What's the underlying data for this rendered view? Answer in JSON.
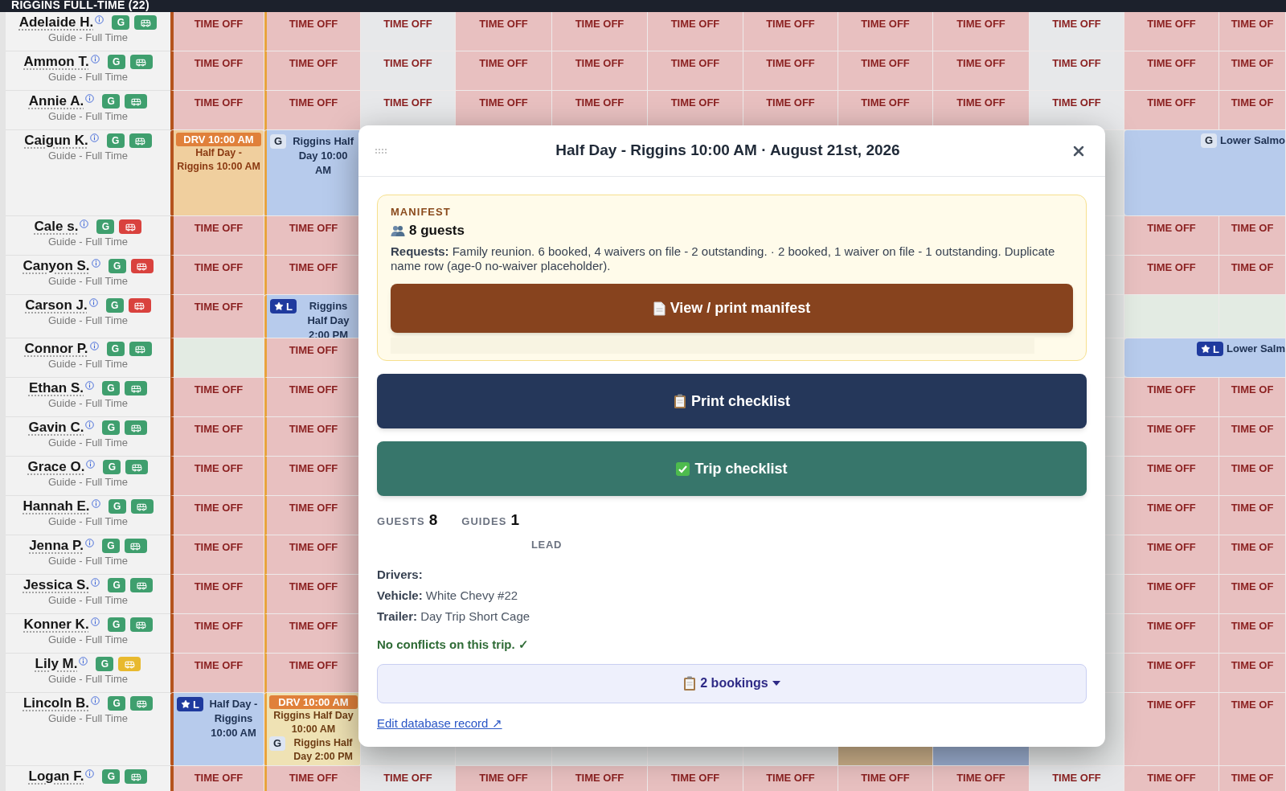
{
  "group": {
    "title": "RIGGINS FULL-TIME (22)"
  },
  "staff": [
    {
      "name": "Adelaide H.",
      "role": "Guide - Full Time",
      "badge": "G",
      "color": "#3f9f6e",
      "cells": [
        {
          "kind": "time_off",
          "text": "TIME OFF"
        },
        {
          "kind": "time_off",
          "text": "TIME OFF"
        },
        {
          "kind": "time_off_grey",
          "text": "TIME OFF"
        },
        {
          "kind": "time_off",
          "text": "TIME OFF"
        },
        {
          "kind": "time_off",
          "text": "TIME OFF"
        },
        {
          "kind": "time_off",
          "text": "TIME OFF"
        },
        {
          "kind": "time_off",
          "text": "TIME OFF"
        },
        {
          "kind": "time_off",
          "text": "TIME OFF"
        },
        {
          "kind": "time_off",
          "text": "TIME OFF"
        },
        {
          "kind": "time_off_grey",
          "text": "TIME OFF"
        },
        {
          "kind": "time_off",
          "text": "TIME OFF"
        },
        {
          "kind": "time_off",
          "text": "TIME OF"
        }
      ]
    },
    {
      "name": "Ammon T.",
      "role": "Guide - Full Time",
      "badge": "G",
      "color": "#3f9f6e",
      "cells": [
        {
          "kind": "time_off",
          "text": "TIME OFF"
        },
        {
          "kind": "time_off",
          "text": "TIME OFF"
        },
        {
          "kind": "time_off_grey",
          "text": "TIME OFF"
        },
        {
          "kind": "time_off",
          "text": "TIME OFF"
        },
        {
          "kind": "time_off",
          "text": "TIME OFF"
        },
        {
          "kind": "time_off",
          "text": "TIME OFF"
        },
        {
          "kind": "time_off",
          "text": "TIME OFF"
        },
        {
          "kind": "time_off",
          "text": "TIME OFF"
        },
        {
          "kind": "time_off",
          "text": "TIME OFF"
        },
        {
          "kind": "time_off_grey",
          "text": "TIME OFF"
        },
        {
          "kind": "time_off",
          "text": "TIME OFF"
        },
        {
          "kind": "time_off",
          "text": "TIME OF"
        }
      ]
    },
    {
      "name": "Annie A.",
      "role": "Guide - Full Time",
      "badge": "G",
      "color": "#3f9f6e",
      "cells": [
        {
          "kind": "time_off",
          "text": "TIME OFF"
        },
        {
          "kind": "time_off",
          "text": "TIME OFF"
        },
        {
          "kind": "time_off_grey",
          "text": "TIME OFF"
        },
        {
          "kind": "time_off",
          "text": "TIME OFF"
        },
        {
          "kind": "time_off",
          "text": "TIME OFF"
        },
        {
          "kind": "time_off",
          "text": "TIME OFF"
        },
        {
          "kind": "time_off",
          "text": "TIME OFF"
        },
        {
          "kind": "time_off",
          "text": "TIME OFF"
        },
        {
          "kind": "time_off",
          "text": "TIME OFF"
        },
        {
          "kind": "time_off_grey",
          "text": "TIME OFF"
        },
        {
          "kind": "time_off",
          "text": "TIME OFF"
        },
        {
          "kind": "time_off",
          "text": "TIME OF"
        }
      ]
    },
    {
      "name": "Caigun K.",
      "role": "Guide - Full Time",
      "badge": "G",
      "color": "#3f9f6e",
      "cells": [
        {
          "kind": "drive",
          "header": "DRV 10:00 AM",
          "text": "Half Day - Riggins 10:00 AM"
        },
        {
          "kind": "trip",
          "lead": false,
          "badge": "G",
          "text": "Riggins Half Day 10:00 AM"
        },
        {
          "kind": "covered"
        },
        {
          "kind": "covered"
        },
        {
          "kind": "covered"
        },
        {
          "kind": "covered"
        },
        {
          "kind": "covered"
        },
        {
          "kind": "covered"
        },
        {
          "kind": "covered"
        },
        {
          "kind": "covered"
        },
        {
          "kind": "trip_wide",
          "lead": false,
          "badge": "G",
          "text": "Lower Salmo"
        }
      ]
    },
    {
      "name": "Cale s.",
      "role": "Guide - Full Time",
      "badge": "G",
      "color": "#d9423e",
      "cells": [
        {
          "kind": "time_off",
          "text": "TIME OFF"
        },
        {
          "kind": "time_off",
          "text": "TIME OFF"
        },
        {
          "kind": "covered"
        },
        {
          "kind": "covered"
        },
        {
          "kind": "covered"
        },
        {
          "kind": "covered"
        },
        {
          "kind": "covered"
        },
        {
          "kind": "covered"
        },
        {
          "kind": "covered"
        },
        {
          "kind": "covered"
        },
        {
          "kind": "time_off",
          "text": "TIME OFF"
        },
        {
          "kind": "time_off",
          "text": "TIME OF"
        }
      ]
    },
    {
      "name": "Canyon S.",
      "role": "Guide - Full Time",
      "badge": "G",
      "color": "#d9423e",
      "cells": [
        {
          "kind": "time_off",
          "text": "TIME OFF"
        },
        {
          "kind": "time_off",
          "text": "TIME OFF"
        },
        {
          "kind": "covered"
        },
        {
          "kind": "covered"
        },
        {
          "kind": "covered"
        },
        {
          "kind": "covered"
        },
        {
          "kind": "covered"
        },
        {
          "kind": "covered"
        },
        {
          "kind": "covered"
        },
        {
          "kind": "covered"
        },
        {
          "kind": "time_off",
          "text": "TIME OFF"
        },
        {
          "kind": "time_off",
          "text": "TIME OF"
        }
      ]
    },
    {
      "name": "Carson J.",
      "role": "Guide - Full Time",
      "badge": "G",
      "color": "#d9423e",
      "cells": [
        {
          "kind": "time_off",
          "text": "TIME OFF"
        },
        {
          "kind": "trip",
          "lead": true,
          "badge": "L",
          "text": "Riggins Half Day 2:00 PM"
        },
        {
          "kind": "covered"
        },
        {
          "kind": "covered"
        },
        {
          "kind": "covered"
        },
        {
          "kind": "covered"
        },
        {
          "kind": "covered"
        },
        {
          "kind": "covered"
        },
        {
          "kind": "covered"
        },
        {
          "kind": "covered"
        },
        {
          "kind": "open"
        },
        {
          "kind": "open"
        }
      ]
    },
    {
      "name": "Connor P.",
      "role": "Guide - Full Time",
      "badge": "G",
      "color": "#3f9f6e",
      "cells": [
        {
          "kind": "open"
        },
        {
          "kind": "time_off",
          "text": "TIME OFF"
        },
        {
          "kind": "covered"
        },
        {
          "kind": "covered"
        },
        {
          "kind": "covered"
        },
        {
          "kind": "covered"
        },
        {
          "kind": "covered"
        },
        {
          "kind": "covered"
        },
        {
          "kind": "covered"
        },
        {
          "kind": "covered"
        },
        {
          "kind": "trip_wide",
          "lead": true,
          "badge": "L",
          "text": "Lower Salm"
        }
      ]
    },
    {
      "name": "Ethan S.",
      "role": "Guide - Full Time",
      "badge": "G",
      "color": "#3f9f6e",
      "cells": [
        {
          "kind": "time_off",
          "text": "TIME OFF"
        },
        {
          "kind": "time_off",
          "text": "TIME OFF"
        },
        {
          "kind": "covered"
        },
        {
          "kind": "covered"
        },
        {
          "kind": "covered"
        },
        {
          "kind": "covered"
        },
        {
          "kind": "covered"
        },
        {
          "kind": "covered"
        },
        {
          "kind": "covered"
        },
        {
          "kind": "covered"
        },
        {
          "kind": "time_off",
          "text": "TIME OFF"
        },
        {
          "kind": "time_off",
          "text": "TIME OF"
        }
      ]
    },
    {
      "name": "Gavin C.",
      "role": "Guide - Full Time",
      "badge": "G",
      "color": "#3f9f6e",
      "cells": [
        {
          "kind": "time_off",
          "text": "TIME OFF"
        },
        {
          "kind": "time_off",
          "text": "TIME OFF"
        },
        {
          "kind": "covered"
        },
        {
          "kind": "covered"
        },
        {
          "kind": "covered"
        },
        {
          "kind": "covered"
        },
        {
          "kind": "covered"
        },
        {
          "kind": "covered"
        },
        {
          "kind": "covered"
        },
        {
          "kind": "covered"
        },
        {
          "kind": "time_off",
          "text": "TIME OFF"
        },
        {
          "kind": "time_off",
          "text": "TIME OF"
        }
      ]
    },
    {
      "name": "Grace O.",
      "role": "Guide - Full Time",
      "badge": "G",
      "color": "#3f9f6e",
      "cells": [
        {
          "kind": "time_off",
          "text": "TIME OFF"
        },
        {
          "kind": "time_off",
          "text": "TIME OFF"
        },
        {
          "kind": "covered"
        },
        {
          "kind": "covered"
        },
        {
          "kind": "covered"
        },
        {
          "kind": "covered"
        },
        {
          "kind": "covered"
        },
        {
          "kind": "covered"
        },
        {
          "kind": "covered"
        },
        {
          "kind": "covered"
        },
        {
          "kind": "time_off",
          "text": "TIME OFF"
        },
        {
          "kind": "time_off",
          "text": "TIME OF"
        }
      ]
    },
    {
      "name": "Hannah E.",
      "role": "Guide - Full Time",
      "badge": "G",
      "color": "#3f9f6e",
      "cells": [
        {
          "kind": "time_off",
          "text": "TIME OFF"
        },
        {
          "kind": "time_off",
          "text": "TIME OFF"
        },
        {
          "kind": "covered"
        },
        {
          "kind": "covered"
        },
        {
          "kind": "covered"
        },
        {
          "kind": "covered"
        },
        {
          "kind": "covered"
        },
        {
          "kind": "covered"
        },
        {
          "kind": "covered"
        },
        {
          "kind": "covered"
        },
        {
          "kind": "time_off",
          "text": "TIME OFF"
        },
        {
          "kind": "time_off",
          "text": "TIME OF"
        }
      ]
    },
    {
      "name": "Jenna P.",
      "role": "Guide - Full Time",
      "badge": "G",
      "color": "#3f9f6e",
      "cells": [
        {
          "kind": "time_off",
          "text": "TIME OFF"
        },
        {
          "kind": "time_off",
          "text": "TIME OFF"
        },
        {
          "kind": "covered"
        },
        {
          "kind": "covered"
        },
        {
          "kind": "covered"
        },
        {
          "kind": "covered"
        },
        {
          "kind": "covered"
        },
        {
          "kind": "covered"
        },
        {
          "kind": "covered"
        },
        {
          "kind": "covered"
        },
        {
          "kind": "time_off",
          "text": "TIME OFF"
        },
        {
          "kind": "time_off",
          "text": "TIME OF"
        }
      ]
    },
    {
      "name": "Jessica S.",
      "role": "Guide - Full Time",
      "badge": "G",
      "color": "#3f9f6e",
      "cells": [
        {
          "kind": "time_off",
          "text": "TIME OFF"
        },
        {
          "kind": "time_off",
          "text": "TIME OFF"
        },
        {
          "kind": "covered"
        },
        {
          "kind": "covered"
        },
        {
          "kind": "covered"
        },
        {
          "kind": "covered"
        },
        {
          "kind": "covered"
        },
        {
          "kind": "covered"
        },
        {
          "kind": "covered"
        },
        {
          "kind": "covered"
        },
        {
          "kind": "time_off",
          "text": "TIME OFF"
        },
        {
          "kind": "time_off",
          "text": "TIME OF"
        }
      ]
    },
    {
      "name": "Konner K.",
      "role": "Guide - Full Time",
      "badge": "G",
      "color": "#3f9f6e",
      "cells": [
        {
          "kind": "time_off",
          "text": "TIME OFF"
        },
        {
          "kind": "time_off",
          "text": "TIME OFF"
        },
        {
          "kind": "covered"
        },
        {
          "kind": "covered"
        },
        {
          "kind": "covered"
        },
        {
          "kind": "covered"
        },
        {
          "kind": "covered"
        },
        {
          "kind": "covered"
        },
        {
          "kind": "covered"
        },
        {
          "kind": "covered"
        },
        {
          "kind": "time_off",
          "text": "TIME OFF"
        },
        {
          "kind": "time_off",
          "text": "TIME OF"
        }
      ]
    },
    {
      "name": "Lily M.",
      "role": "Guide - Full Time",
      "badge": "G",
      "color": "#e8b92e",
      "cells": [
        {
          "kind": "time_off",
          "text": "TIME OFF"
        },
        {
          "kind": "time_off",
          "text": "TIME OFF"
        },
        {
          "kind": "covered"
        },
        {
          "kind": "covered"
        },
        {
          "kind": "covered"
        },
        {
          "kind": "covered"
        },
        {
          "kind": "covered"
        },
        {
          "kind": "covered"
        },
        {
          "kind": "covered"
        },
        {
          "kind": "covered"
        },
        {
          "kind": "time_off",
          "text": "TIME OFF"
        },
        {
          "kind": "time_off",
          "text": "TIME OF"
        }
      ]
    },
    {
      "name": "Lincoln B.",
      "role": "Guide - Full Time",
      "badge": "G",
      "color": "#3f9f6e",
      "cells": [
        {
          "kind": "trip",
          "lead": true,
          "badge": "L",
          "text": "Half Day - Riggins 10:00 AM"
        },
        {
          "kind": "drive_combo",
          "header": "DRV 10:00 AM",
          "text": "Riggins Half Day 10:00 AM",
          "trip": {
            "lead": false,
            "badge": "G",
            "text": "Riggins Half Day 2:00 PM"
          }
        },
        {
          "kind": "covered"
        },
        {
          "kind": "covered"
        },
        {
          "kind": "covered"
        },
        {
          "kind": "covered"
        },
        {
          "kind": "covered"
        },
        {
          "kind": "covered_drive"
        },
        {
          "kind": "covered_trip"
        },
        {
          "kind": "covered"
        },
        {
          "kind": "time_off",
          "text": "TIME OFF"
        },
        {
          "kind": "time_off",
          "text": "TIME OF"
        }
      ]
    },
    {
      "name": "Logan F.",
      "badge": "G",
      "color": "#3f9f6e",
      "cells": [
        {
          "kind": "time_off",
          "text": "TIME OFF"
        },
        {
          "kind": "time_off",
          "text": "TIME OFF"
        },
        {
          "kind": "time_off_grey",
          "text": "TIME OFF"
        },
        {
          "kind": "time_off",
          "text": "TIME OFF"
        },
        {
          "kind": "time_off",
          "text": "TIME OFF"
        },
        {
          "kind": "time_off",
          "text": "TIME OFF"
        },
        {
          "kind": "time_off",
          "text": "TIME OFF"
        },
        {
          "kind": "time_off",
          "text": "TIME OFF"
        },
        {
          "kind": "time_off",
          "text": "TIME OFF"
        },
        {
          "kind": "time_off_grey",
          "text": "TIME OFF"
        },
        {
          "kind": "time_off",
          "text": "TIME OFF"
        },
        {
          "kind": "time_off",
          "text": "TIME OF"
        }
      ]
    }
  ],
  "dialog": {
    "title": "Half Day - Riggins 10:00 AM · August 21st, 2026",
    "manifest": {
      "heading": "MANIFEST",
      "guests": "8 guests",
      "requests": "**Requests:** Family reunion. 6 booked, 4 waivers on file - 2 outstanding. · 2 booked, 1 waiver on file - 1 outstanding. Duplicate name row (age-0 no-waiver placeholder).",
      "button": "View / print manifest"
    },
    "actions": [
      {
        "kind": "print",
        "label": "Print checklist"
      },
      {
        "kind": "trip",
        "label": "Trip checklist"
      }
    ],
    "stats": [
      {
        "label": "GUESTS",
        "value": "8"
      },
      {
        "label": "GUIDES",
        "value": "1"
      }
    ],
    "guide_role": "LEAD",
    "details": [
      {
        "label": "Drivers:"
      },
      {
        "label": "Vehicle:",
        "value": "White Chevy #22"
      },
      {
        "label": "Trailer:",
        "value": "Day Trip Short Cage"
      }
    ],
    "conflicts": "No conflicts on this trip. ✓",
    "bookings": {
      "label": "2 bookings",
      "expanded": false
    },
    "link": "Edit database record ↗"
  }
}
